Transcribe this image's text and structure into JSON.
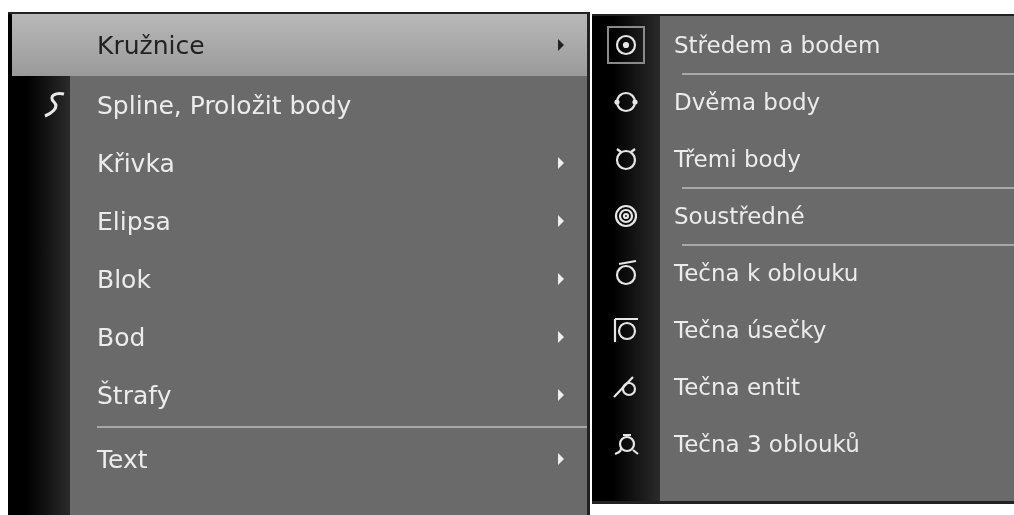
{
  "menu": {
    "items": [
      {
        "label": "Kružnice",
        "selected": true,
        "submenu": true,
        "separator_before": false
      },
      {
        "label": "Spline, Proložit body",
        "selected": false,
        "submenu": false,
        "separator_before": false
      },
      {
        "label": "Křivka",
        "selected": false,
        "submenu": true,
        "separator_before": false
      },
      {
        "label": "Elipsa",
        "selected": false,
        "submenu": true,
        "separator_before": false
      },
      {
        "label": "Blok",
        "selected": false,
        "submenu": true,
        "separator_before": false
      },
      {
        "label": "Bod",
        "selected": false,
        "submenu": true,
        "separator_before": false
      },
      {
        "label": "Štrafy",
        "selected": false,
        "submenu": true,
        "separator_before": false
      },
      {
        "label": "Text",
        "selected": false,
        "submenu": true,
        "separator_before": true
      }
    ]
  },
  "submenu": {
    "items": [
      {
        "label": "Středem a bodem",
        "selected": true,
        "separator_before": false
      },
      {
        "label": "Dvěma body",
        "selected": false,
        "separator_before": true
      },
      {
        "label": "Třemi body",
        "selected": false,
        "separator_before": false
      },
      {
        "label": "Soustředné",
        "selected": false,
        "separator_before": true
      },
      {
        "label": "Tečna k oblouku",
        "selected": false,
        "separator_before": true
      },
      {
        "label": "Tečna úsečky",
        "selected": false,
        "separator_before": false
      },
      {
        "label": "Tečna entit",
        "selected": false,
        "separator_before": false
      },
      {
        "label": "Tečna 3 oblouků",
        "selected": false,
        "separator_before": false
      }
    ]
  }
}
